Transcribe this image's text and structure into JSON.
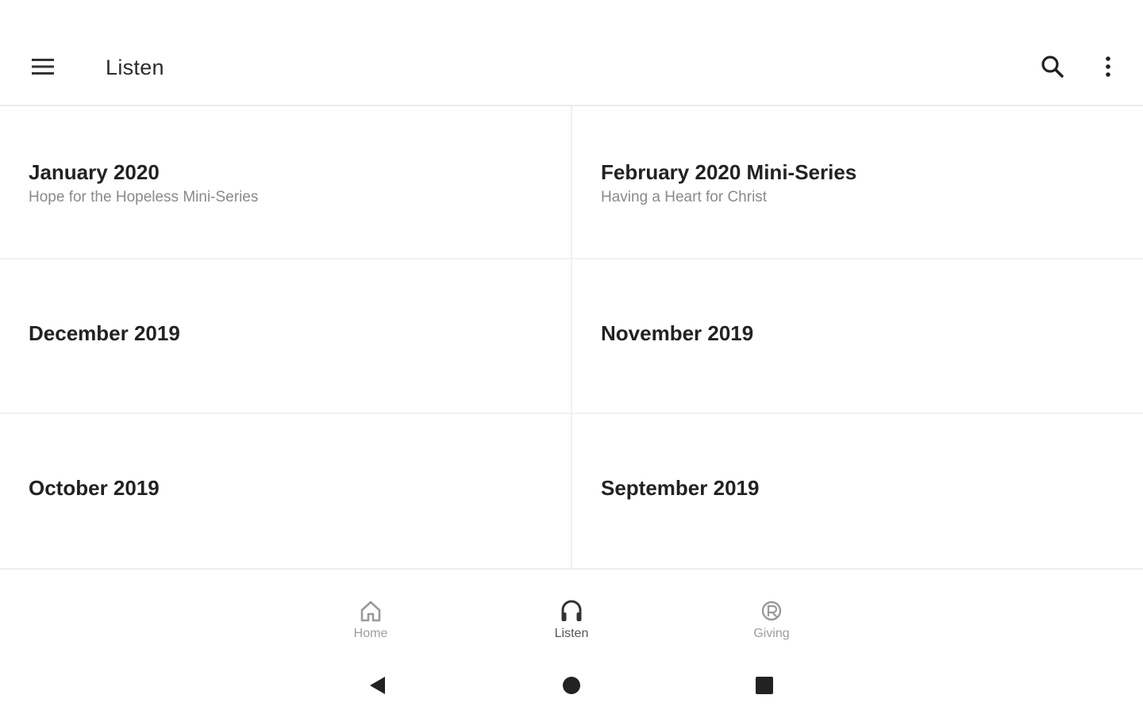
{
  "app_bar": {
    "title": "Listen",
    "menu_icon": "menu-icon",
    "search_icon": "search-icon",
    "more_icon": "more-vert-icon"
  },
  "series": [
    {
      "title": "January 2020",
      "subtitle": "Hope for the Hopeless Mini-Series"
    },
    {
      "title": "February 2020 Mini-Series",
      "subtitle": "Having a Heart for Christ"
    },
    {
      "title": "December 2019",
      "subtitle": ""
    },
    {
      "title": "November 2019",
      "subtitle": ""
    },
    {
      "title": "October 2019",
      "subtitle": ""
    },
    {
      "title": "September 2019",
      "subtitle": ""
    }
  ],
  "bottom_nav": {
    "items": [
      {
        "label": "Home",
        "icon": "home-icon",
        "active": false
      },
      {
        "label": "Listen",
        "icon": "headphones-icon",
        "active": true
      },
      {
        "label": "Giving",
        "icon": "giving-icon",
        "active": false
      }
    ]
  },
  "system_nav": {
    "back_icon": "back-triangle-icon",
    "home_icon": "home-circle-icon",
    "recents_icon": "recents-square-icon"
  }
}
